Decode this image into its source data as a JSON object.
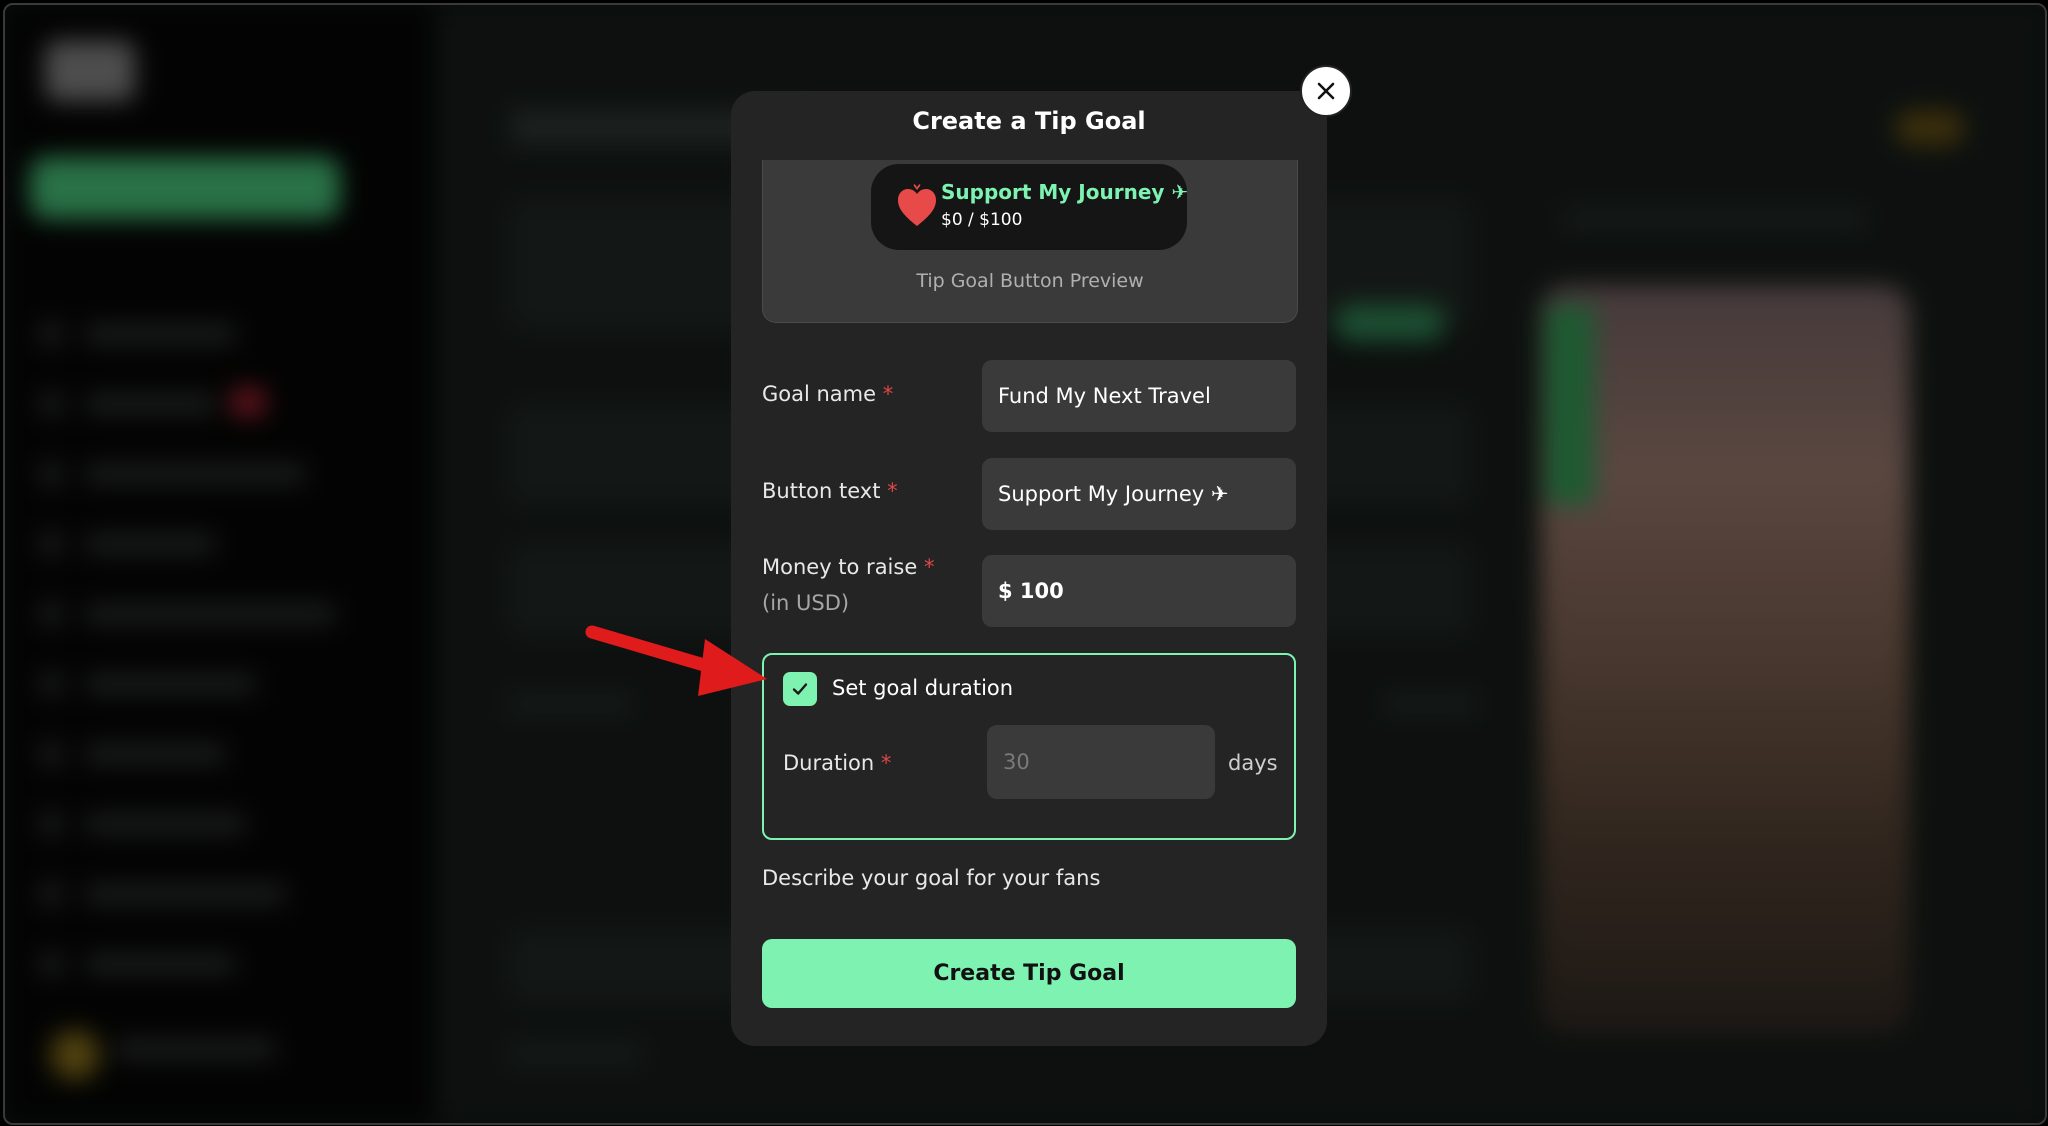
{
  "modal": {
    "title": "Create a Tip Goal",
    "preview": {
      "button_label": "Support My Journey ✈",
      "progress": "$0 / $100",
      "caption": "Tip Goal Button Preview"
    },
    "fields": {
      "goal_name": {
        "label": "Goal name",
        "required_mark": "*",
        "value": "Fund My Next Travel"
      },
      "button_text": {
        "label": "Button text",
        "required_mark": "*",
        "value": "Support My Journey ✈"
      },
      "money": {
        "label": "Money to raise",
        "required_mark": "*",
        "sub_label": "(in USD)",
        "value": "$ 100"
      }
    },
    "goal_duration": {
      "checkbox_label": "Set goal duration",
      "checked": true,
      "duration_label": "Duration",
      "required_mark": "*",
      "placeholder": "30",
      "unit": "days"
    },
    "describe_label": "Describe your goal for your fans",
    "submit_label": "Create Tip Goal"
  },
  "colors": {
    "accent": "#7ef2b0",
    "required": "#e04646",
    "annotation_arrow": "#e01b1b",
    "heart": "#e84a4a"
  }
}
